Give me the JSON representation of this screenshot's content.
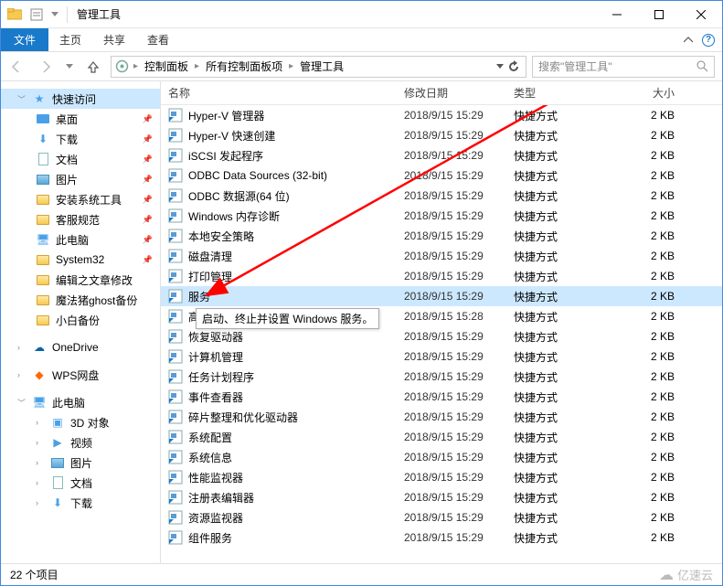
{
  "window": {
    "title": "管理工具"
  },
  "ribbon": {
    "file": "文件",
    "tabs": [
      "主页",
      "共享",
      "查看"
    ]
  },
  "breadcrumb": {
    "items": [
      "控制面板",
      "所有控制面板项",
      "管理工具"
    ]
  },
  "search": {
    "placeholder": "搜索\"管理工具\""
  },
  "nav": {
    "quick_access": "快速访问",
    "items": [
      {
        "label": "桌面",
        "pin": true,
        "icon": "desktop"
      },
      {
        "label": "下载",
        "pin": true,
        "icon": "download"
      },
      {
        "label": "文档",
        "pin": true,
        "icon": "doc"
      },
      {
        "label": "图片",
        "pin": true,
        "icon": "pic"
      },
      {
        "label": "安装系统工具",
        "pin": true,
        "icon": "folder"
      },
      {
        "label": "客服规范",
        "pin": true,
        "icon": "folder"
      },
      {
        "label": "此电脑",
        "pin": true,
        "icon": "pc"
      },
      {
        "label": "System32",
        "pin": true,
        "icon": "folder"
      },
      {
        "label": "编辑之文章修改",
        "pin": false,
        "icon": "folder"
      },
      {
        "label": "魔法猪ghost备份",
        "pin": false,
        "icon": "folder"
      },
      {
        "label": "小白备份",
        "pin": false,
        "icon": "folder"
      }
    ],
    "onedrive": "OneDrive",
    "wps": "WPS网盘",
    "this_pc": "此电脑",
    "pc_children": [
      {
        "label": "3D 对象",
        "icon": "3d"
      },
      {
        "label": "视频",
        "icon": "video"
      },
      {
        "label": "图片",
        "icon": "pic"
      },
      {
        "label": "文档",
        "icon": "doc"
      },
      {
        "label": "下载",
        "icon": "download"
      }
    ]
  },
  "columns": {
    "name": "名称",
    "date": "修改日期",
    "type": "类型",
    "size": "大小"
  },
  "files": [
    {
      "name": "Hyper-V 管理器",
      "date": "2018/9/15 15:29",
      "type": "快捷方式",
      "size": "2 KB"
    },
    {
      "name": "Hyper-V 快速创建",
      "date": "2018/9/15 15:29",
      "type": "快捷方式",
      "size": "2 KB"
    },
    {
      "name": "iSCSI 发起程序",
      "date": "2018/9/15 15:29",
      "type": "快捷方式",
      "size": "2 KB"
    },
    {
      "name": "ODBC Data Sources (32-bit)",
      "date": "2018/9/15 15:29",
      "type": "快捷方式",
      "size": "2 KB"
    },
    {
      "name": "ODBC 数据源(64 位)",
      "date": "2018/9/15 15:29",
      "type": "快捷方式",
      "size": "2 KB"
    },
    {
      "name": "Windows 内存诊断",
      "date": "2018/9/15 15:29",
      "type": "快捷方式",
      "size": "2 KB"
    },
    {
      "name": "本地安全策略",
      "date": "2018/9/15 15:29",
      "type": "快捷方式",
      "size": "2 KB"
    },
    {
      "name": "磁盘清理",
      "date": "2018/9/15 15:29",
      "type": "快捷方式",
      "size": "2 KB"
    },
    {
      "name": "打印管理",
      "date": "2018/9/15 15:29",
      "type": "快捷方式",
      "size": "2 KB"
    },
    {
      "name": "服务",
      "date": "2018/9/15 15:29",
      "type": "快捷方式",
      "size": "2 KB",
      "selected": true
    },
    {
      "name": "高级安全 Windows Defender 防火墙",
      "date": "2018/9/15 15:28",
      "type": "快捷方式",
      "size": "2 KB"
    },
    {
      "name": "恢复驱动器",
      "date": "2018/9/15 15:29",
      "type": "快捷方式",
      "size": "2 KB"
    },
    {
      "name": "计算机管理",
      "date": "2018/9/15 15:29",
      "type": "快捷方式",
      "size": "2 KB"
    },
    {
      "name": "任务计划程序",
      "date": "2018/9/15 15:29",
      "type": "快捷方式",
      "size": "2 KB"
    },
    {
      "name": "事件查看器",
      "date": "2018/9/15 15:29",
      "type": "快捷方式",
      "size": "2 KB"
    },
    {
      "name": "碎片整理和优化驱动器",
      "date": "2018/9/15 15:29",
      "type": "快捷方式",
      "size": "2 KB"
    },
    {
      "name": "系统配置",
      "date": "2018/9/15 15:29",
      "type": "快捷方式",
      "size": "2 KB"
    },
    {
      "name": "系统信息",
      "date": "2018/9/15 15:29",
      "type": "快捷方式",
      "size": "2 KB"
    },
    {
      "name": "性能监视器",
      "date": "2018/9/15 15:29",
      "type": "快捷方式",
      "size": "2 KB"
    },
    {
      "name": "注册表编辑器",
      "date": "2018/9/15 15:29",
      "type": "快捷方式",
      "size": "2 KB"
    },
    {
      "name": "资源监视器",
      "date": "2018/9/15 15:29",
      "type": "快捷方式",
      "size": "2 KB"
    },
    {
      "name": "组件服务",
      "date": "2018/9/15 15:29",
      "type": "快捷方式",
      "size": "2 KB"
    }
  ],
  "tooltip": "启动、终止并设置 Windows 服务。",
  "status": {
    "item_count": "22 个项目"
  },
  "watermark": "亿速云"
}
